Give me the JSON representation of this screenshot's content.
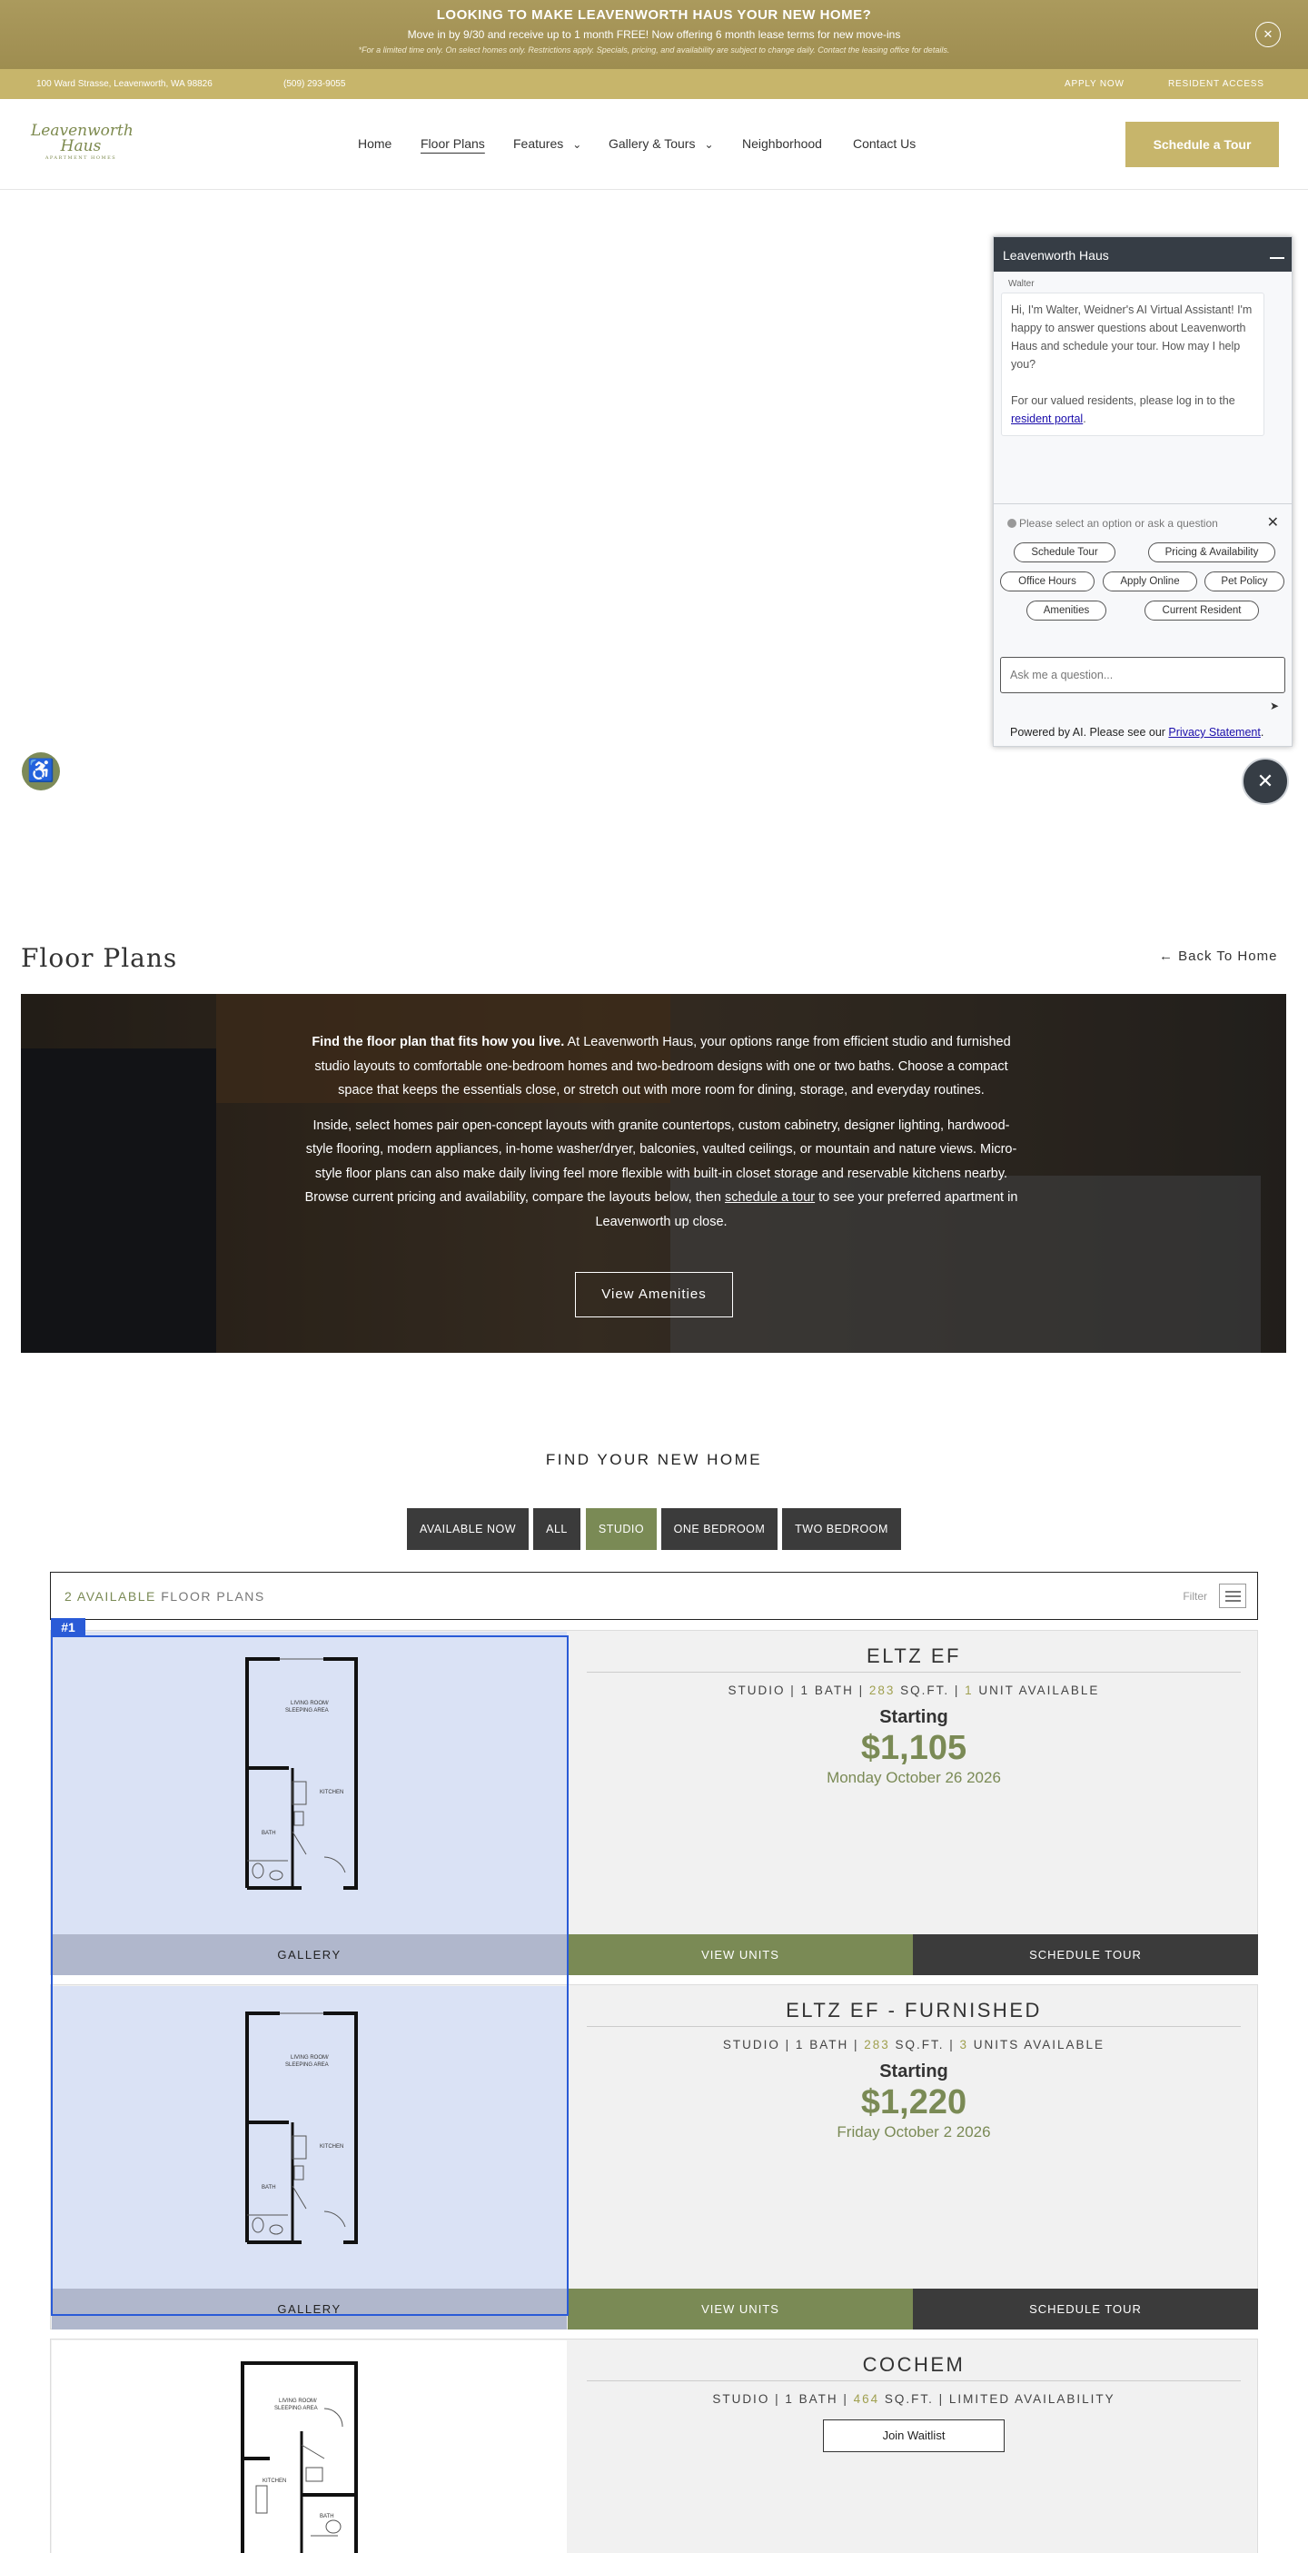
{
  "promo": {
    "title": "LOOKING TO MAKE LEAVENWORTH HAUS YOUR NEW HOME?",
    "line": "Move in by 9/30 and receive up to 1 month FREE! Now offering 6 month lease terms for new move-ins",
    "fine": "*For a limited time only. On select homes only. Restrictions apply. Specials, pricing, and availability are subject to change daily. Contact the leasing office for details.",
    "close": "✕"
  },
  "infobar": {
    "address": "100 Ward Strasse, Leavenworth, WA 98826",
    "phone": "(509) 293-9055",
    "apply": "APPLY NOW",
    "resident": "RESIDENT ACCESS"
  },
  "header": {
    "logo_line1": "Leavenworth",
    "logo_line2": "Haus",
    "logo_line3": "APARTMENT HOMES",
    "nav": [
      "Home",
      "Floor Plans",
      "Features",
      "Gallery & Tours",
      "Neighborhood",
      "Contact Us"
    ],
    "schedule": "Schedule a Tour"
  },
  "chat": {
    "title": "Leavenworth Haus",
    "author": "Walter",
    "message_1": "Hi, I'm Walter, Weidner's AI Virtual Assistant! I'm happy to answer questions about Leavenworth Haus and schedule your tour. How may I help you?",
    "message_2": "For our valued residents, please log in to the ",
    "message_link": "resident portal",
    "message_end": ".",
    "prompt": "Please select an option or ask a question",
    "options": [
      "Schedule Tour",
      "Pricing & Availability",
      "Office Hours",
      "Apply Online",
      "Pet Policy",
      "Amenities",
      "Current Resident"
    ],
    "input_placeholder": "Ask me a question...",
    "footer": "Powered by AI. Please see our ",
    "footer_link": "Privacy Statement",
    "footer_end": "."
  },
  "floorplans": {
    "title": "Floor Plans",
    "back": "← Back To Home",
    "hero_p1_bold": "Find the floor plan that fits how you live.",
    "hero_p1": " At Leavenworth Haus, your options range from efficient studio and furnished studio layouts to comfortable one-bedroom homes and two-bedroom designs with one or two baths. Choose a compact space that keeps the essentials close, or stretch out with more room for dining, storage, and everyday routines.",
    "hero_p2a": "Inside, select homes pair open-concept layouts with granite countertops, custom cabinetry, designer lighting, hardwood-style flooring, modern appliances, in-home washer/dryer, balconies, vaulted ceilings, or mountain and nature views. Micro-style floor plans can also make daily living feel more flexible with built-in closet storage and reservable kitchens nearby. Browse current pricing and availability, compare the layouts below, then ",
    "hero_link": "schedule a tour",
    "hero_p2b": " to see your preferred apartment in Leavenworth up close.",
    "view_amenities": "View Amenities"
  },
  "find": {
    "title": "FIND YOUR NEW HOME",
    "filters": [
      "AVAILABLE NOW",
      "ALL",
      "STUDIO",
      "ONE BEDROOM",
      "TWO BEDROOM"
    ],
    "active_filter": "STUDIO",
    "count_num": "2 AVAILABLE",
    "count_label": "FLOOR PLANS",
    "filter_label": "Filter"
  },
  "highlight_tag": "#1",
  "plans": [
    {
      "name": "ELTZ EF",
      "meta_a": "STUDIO | 1 BATH | ",
      "sqft": "283",
      "meta_b": " SQ.FT. | ",
      "units_num": "1",
      "meta_c": " UNIT AVAILABLE",
      "starting": "Starting",
      "price": "$1,105",
      "date": "Monday October 26 2026",
      "gallery": "GALLERY",
      "view_units": "VIEW UNITS",
      "schedule_tour": "SCHEDULE TOUR",
      "labels": {
        "living": "LIVING ROOM/",
        "sleeping": "SLEEPING AREA",
        "kitchen": "KITCHEN",
        "bath": "BATH"
      }
    },
    {
      "name": "ELTZ EF - FURNISHED",
      "meta_a": "STUDIO | 1 BATH | ",
      "sqft": "283",
      "meta_b": " SQ.FT. | ",
      "units_num": "3",
      "meta_c": " UNITS AVAILABLE",
      "starting": "Starting",
      "price": "$1,220",
      "date": "Friday October 2 2026",
      "gallery": "GALLERY",
      "view_units": "VIEW UNITS",
      "schedule_tour": "SCHEDULE TOUR",
      "labels": {
        "living": "LIVING ROOM/",
        "sleeping": "SLEEPING AREA",
        "kitchen": "KITCHEN",
        "bath": "BATH"
      }
    },
    {
      "name": "COCHEM",
      "meta_a": "STUDIO | 1 BATH | ",
      "sqft": "464",
      "meta_b": " SQ.FT. | LIMITED AVAILABILITY",
      "waitlist": "Join Waitlist",
      "labels": {
        "living": "LIVING ROOM/",
        "sleeping": "SLEEPING AREA",
        "kitchen": "KITCHEN",
        "bath": "BATH"
      }
    }
  ],
  "colors": {
    "gold": "#c7b56b",
    "olive": "#7a8a55",
    "dark": "#3b3b3b",
    "highlight": "#2a5bd7"
  },
  "icons": {
    "accessibility": "♿",
    "chevron": "⌄",
    "send": "➤",
    "chat_close": "✕"
  }
}
